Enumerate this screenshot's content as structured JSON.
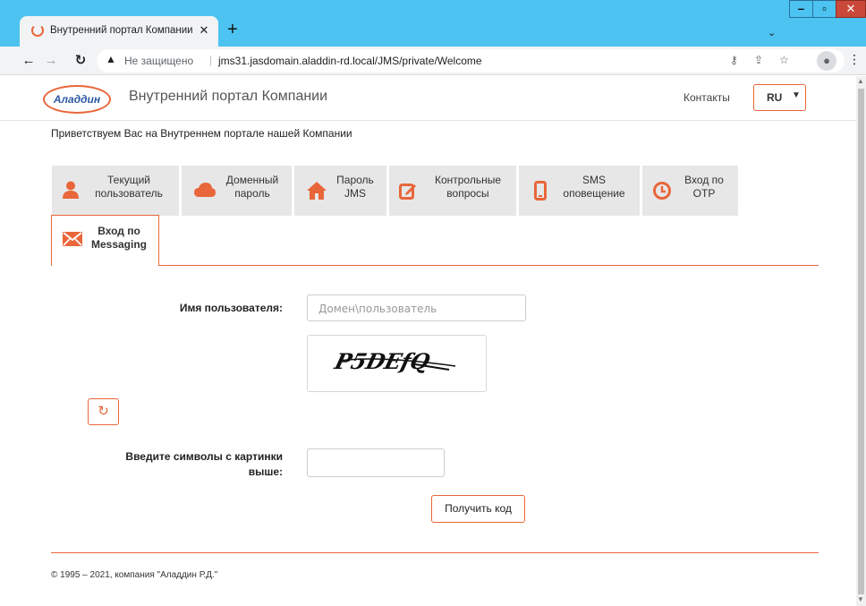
{
  "browser": {
    "tab_title": "Внутренний портал Компании",
    "tab_close": "✕",
    "new_tab": "+",
    "security_label": "Не защищено",
    "url": "jms31.jasdomain.aladdin-rd.local/JMS/private/Welcome",
    "icons": [
      "back-icon",
      "forward-icon",
      "reload-icon",
      "warning-icon",
      "key-icon",
      "share-icon",
      "star-icon",
      "profile-icon",
      "menu-icon"
    ]
  },
  "header": {
    "logo_text": "Аладдин",
    "title": "Внутренний портал Компании",
    "contacts": "Контакты",
    "lang": "RU"
  },
  "welcome": "Приветствуем Вас на Внутреннем портале нашей Компании",
  "menu": {
    "items": [
      {
        "line1": "Текущий",
        "line2": "пользователь",
        "icon": "user-icon"
      },
      {
        "line1": "Доменный",
        "line2": "пароль",
        "icon": "cloud-icon"
      },
      {
        "line1": "Пароль",
        "line2": "JMS",
        "icon": "home-icon"
      },
      {
        "line1": "Контрольные",
        "line2": "вопросы",
        "icon": "edit-icon"
      },
      {
        "line1": "SMS",
        "line2": "оповещение",
        "icon": "phone-icon"
      },
      {
        "line1": "Вход по",
        "line2": "OTP",
        "icon": "clock-icon"
      },
      {
        "line1": "Вход по",
        "line2": "Messaging",
        "icon": "envelope-icon",
        "active": true
      }
    ]
  },
  "form": {
    "username_label": "Имя пользователя:",
    "username_placeholder": "Домен\\пользователь",
    "captcha_text": "P5DEfQ",
    "captcha_label_line1": "Введите символы с картинки",
    "captcha_label_line2": "выше:",
    "submit": "Получить код"
  },
  "footer": {
    "copyright": "© 1995 – 2021, компания \"Аладдин Р.Д.\""
  },
  "colors": {
    "accent": "#e8663a",
    "tab_bg": "#e7e7e7",
    "chrome_tabbar": "#4cc3f0",
    "logo_blue": "#2d5aa6"
  }
}
